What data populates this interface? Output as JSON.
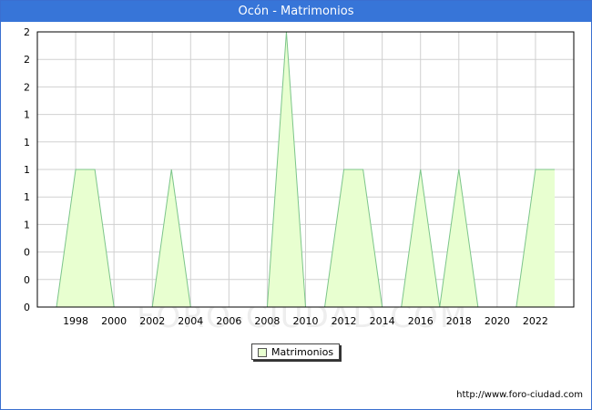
{
  "page": {
    "title": "Ocón - Matrimonios",
    "source_url": "http://www.foro-ciudad.com",
    "watermark": "FORO-CIUDAD.COM"
  },
  "colors": {
    "title_bar": "#3775d8",
    "area_fill": "#e8ffd0",
    "area_line": "#7cc58a",
    "grid": "#d0d0d0"
  },
  "chart_data": {
    "type": "area",
    "title": "Ocón - Matrimonios",
    "xlabel": "",
    "ylabel": "",
    "x_ticks": [
      "1998",
      "2000",
      "2002",
      "2004",
      "2006",
      "2008",
      "2010",
      "2012",
      "2014",
      "2016",
      "2018",
      "2020",
      "2022"
    ],
    "y_ticks": [
      "0",
      "0",
      "0",
      "1",
      "1",
      "1",
      "1",
      "1",
      "2",
      "2",
      "2"
    ],
    "ylim": [
      0,
      2
    ],
    "xlim": [
      1996,
      2024
    ],
    "grid": true,
    "legend": "bottom-center",
    "series": [
      {
        "name": "Matrimonios",
        "x": [
          1997,
          1998,
          1999,
          2000,
          2001,
          2002,
          2003,
          2004,
          2005,
          2006,
          2007,
          2008,
          2009,
          2010,
          2011,
          2012,
          2013,
          2014,
          2015,
          2016,
          2017,
          2018,
          2019,
          2020,
          2021,
          2022,
          2023
        ],
        "values": [
          0,
          1,
          1,
          0,
          0,
          0,
          1,
          0,
          0,
          0,
          0,
          0,
          2,
          0,
          0,
          1,
          1,
          0,
          0,
          1,
          0,
          1,
          0,
          0,
          0,
          1,
          1
        ]
      }
    ]
  }
}
